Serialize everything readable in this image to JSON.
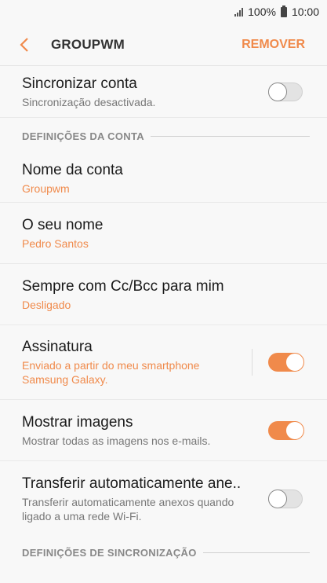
{
  "status": {
    "battery": "100%",
    "time": "10:00"
  },
  "header": {
    "title": "GROUPWM",
    "remove_label": "REMOVER"
  },
  "sync": {
    "title": "Sincronizar conta",
    "subtitle": "Sincronização desactivada.",
    "enabled": false
  },
  "section_account": {
    "label": "DEFINIÇÕES DA CONTA"
  },
  "account_name": {
    "title": "Nome da conta",
    "value": "Groupwm"
  },
  "your_name": {
    "title": "O seu nome",
    "value": "Pedro Santos"
  },
  "cc_bcc": {
    "title": "Sempre com Cc/Bcc para mim",
    "value": "Desligado"
  },
  "signature": {
    "title": "Assinatura",
    "value": "Enviado a partir do meu smartphone Samsung Galaxy.",
    "enabled": true
  },
  "show_images": {
    "title": "Mostrar imagens",
    "subtitle": "Mostrar todas as imagens nos e-mails.",
    "enabled": true
  },
  "auto_download": {
    "title": "Transferir automaticamente ane..",
    "subtitle": "Transferir automaticamente anexos quando ligado a uma rede Wi-Fi.",
    "enabled": false
  },
  "section_sync": {
    "label": "DEFINIÇÕES DE SINCRONIZAÇÃO"
  },
  "colors": {
    "accent": "#f08a4b"
  }
}
